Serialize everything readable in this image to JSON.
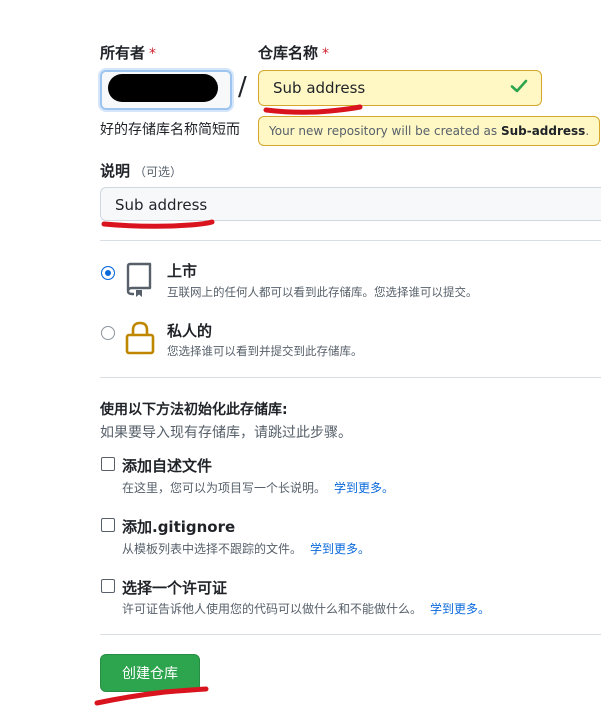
{
  "owner": {
    "label": "所有者",
    "required_mark": "*"
  },
  "separator": "/",
  "repo_name": {
    "label": "仓库名称",
    "required_mark": "*",
    "value": "Sub address"
  },
  "hint": "好的存储库名称简短而",
  "availability_tooltip": {
    "prefix": "Your new repository will be created as",
    "name": "Sub-address",
    "suffix": "."
  },
  "description": {
    "label": "说明",
    "optional": "（可选）",
    "value": "Sub address"
  },
  "visibility": {
    "public": {
      "title": "上市",
      "desc": "互联网上的任何人都可以看到此存储库。您选择谁可以提交。",
      "selected": true
    },
    "private": {
      "title": "私人的",
      "desc": "您选择谁可以看到并提交到此存储库。",
      "selected": false
    }
  },
  "init": {
    "title": "使用以下方法初始化此存储库:",
    "subtitle": "如果要导入现有存储库，请跳过此步骤。",
    "readme": {
      "title": "添加自述文件",
      "desc": "在这里，您可以为项目写一个长说明。",
      "link": "学到更多。"
    },
    "gitignore": {
      "title": "添加.gitignore",
      "desc": "从模板列表中选择不跟踪的文件。",
      "link": "学到更多。"
    },
    "license": {
      "title": "选择一个许可证",
      "desc": "许可证告诉他人使用您的代码可以做什么和不能做什么。",
      "link": "学到更多。"
    }
  },
  "create_button": "创建仓库",
  "colors": {
    "accent_green": "#2da44e",
    "link_blue": "#0969da",
    "required_red": "#cf222e",
    "annotation_red": "#d9141e"
  }
}
